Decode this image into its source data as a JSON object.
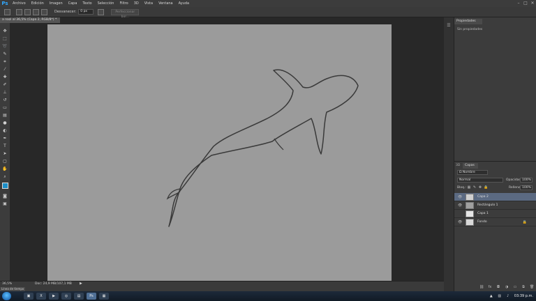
{
  "app": {
    "logo": "Ps"
  },
  "menu": [
    "Archivo",
    "Edición",
    "Imagen",
    "Capa",
    "Texto",
    "Selección",
    "Filtro",
    "3D",
    "Vista",
    "Ventana",
    "Ayuda"
  ],
  "window_controls": {
    "minimize": "–",
    "maximize": "□",
    "close": "✕"
  },
  "options": {
    "feather_label": "Desvanecer:",
    "feather_value": "0 px",
    "refine_label": "Perfeccionar bor..."
  },
  "document": {
    "tab_title": "a nazi al 36,5% (Capa 2, RGB/8*) *"
  },
  "status": {
    "zoom": "36,5%",
    "doc_info": "Doc: 24,9 MB/107,1 MB",
    "arrow": "▶"
  },
  "timeline": {
    "label": "Línea de tiempo"
  },
  "properties": {
    "tab": "Propiedades",
    "message": "Sin propiedades"
  },
  "layers_panel": {
    "tab_3d": "3D",
    "tab_layers": "Capas",
    "filter_kind": "Ω Nombre",
    "blend_mode": "Normal",
    "opacity_label": "Opacidad:",
    "opacity_value": "100%",
    "lock_label": "Bloq.:",
    "fill_label": "Relleno:",
    "fill_value": "100%",
    "layers": [
      {
        "name": "Capa 2",
        "visible": true,
        "selected": true,
        "thumb": "#cfcfcf"
      },
      {
        "name": "Rectángulo 1",
        "visible": true,
        "selected": false,
        "thumb": "#a0a0a0"
      },
      {
        "name": "Capa 1",
        "visible": false,
        "selected": false,
        "thumb": "#e6e6e6"
      },
      {
        "name": "Fondo",
        "visible": true,
        "selected": false,
        "thumb": "#d8d8d8"
      }
    ]
  },
  "taskbar": {
    "clock": "03:39 p.m."
  },
  "colors": {
    "canvas": "#9b9b9b",
    "selected_layer": "#5b6a82",
    "ps_blue": "#31a8ff"
  }
}
